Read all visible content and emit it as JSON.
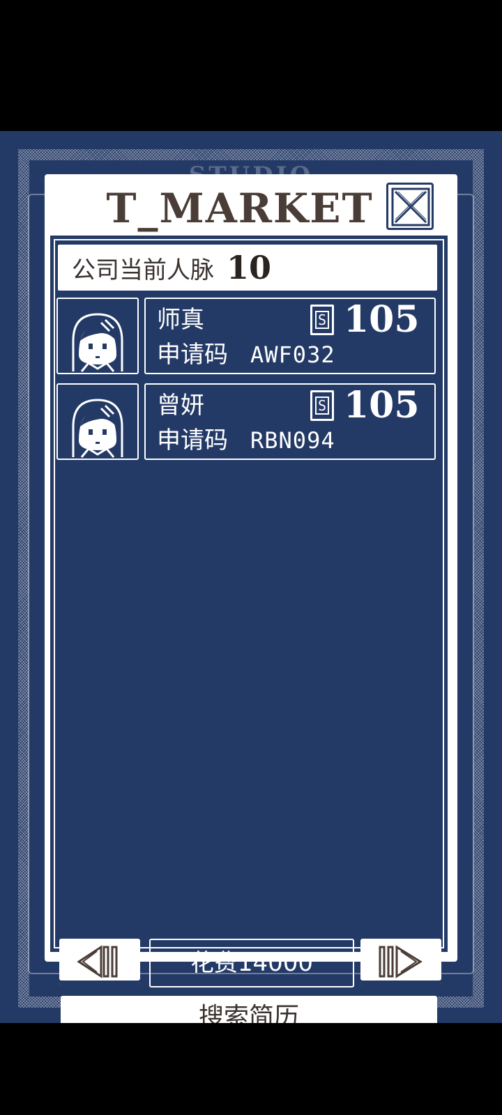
{
  "background": {
    "watermark": "STUDIO"
  },
  "panel": {
    "title": "T_MARKET",
    "close_icon": "close-x-icon"
  },
  "contacts": {
    "label": "公司当前人脉",
    "value": "10"
  },
  "candidates": [
    {
      "name": "师真",
      "code_label": "申请码",
      "code": "AWF032",
      "score": "105",
      "score_icon": "s-badge-icon"
    },
    {
      "name": "曾妍",
      "code_label": "申请码",
      "code": "RBN094",
      "score": "105",
      "score_icon": "s-badge-icon"
    }
  ],
  "pager": {
    "prev_icon": "prev-arrow-icon",
    "next_icon": "next-arrow-icon",
    "cost_label": "花费14000"
  },
  "search_button": "搜索简历",
  "colors": {
    "bg": "#243a66",
    "panel": "#ffffff",
    "title": "#4a3c36"
  }
}
